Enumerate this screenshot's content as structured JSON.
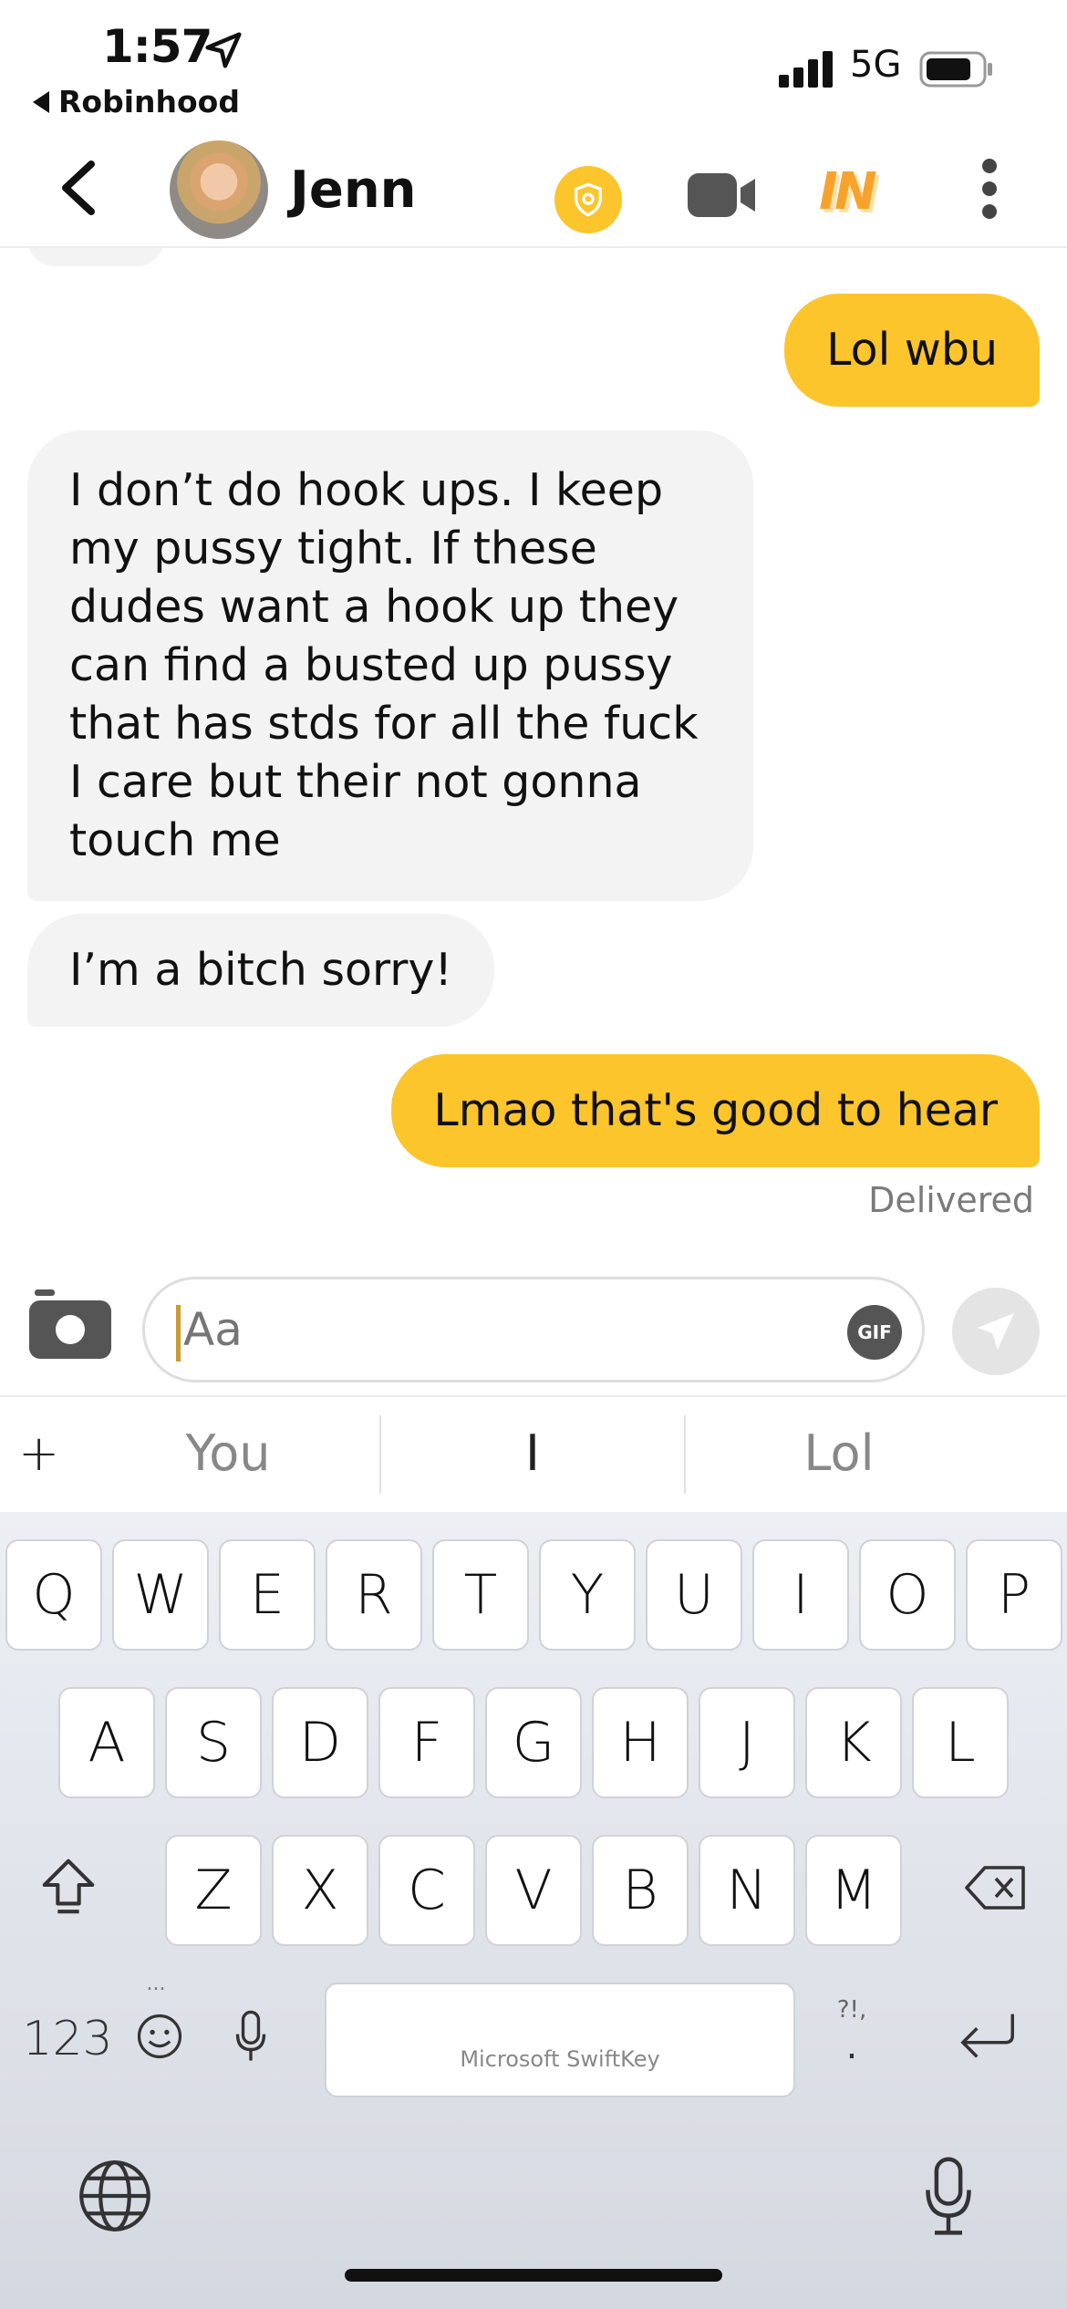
{
  "status_bar": {
    "time": "1:57",
    "back_app": "Robinhood",
    "network": "5G"
  },
  "header": {
    "contact_name": "Jenn",
    "in_badge": "IN"
  },
  "messages": [
    {
      "direction": "out",
      "text": "Lol wbu"
    },
    {
      "direction": "in",
      "text": "I don’t do hook ups. I keep my pussy tight. If these dudes want a hook up they can find a busted up pussy that has stds for all the fuck I care but their not gonna touch me"
    },
    {
      "direction": "in",
      "text": "I’m a bitch sorry!"
    },
    {
      "direction": "out",
      "text": "Lmao that's good to hear"
    }
  ],
  "delivery_status": "Delivered",
  "composer": {
    "placeholder": "Aa",
    "gif_label": "GIF"
  },
  "suggestions": {
    "plus": "+",
    "items": [
      "You",
      "I",
      "Lol"
    ]
  },
  "keyboard": {
    "row1": [
      "Q",
      "W",
      "E",
      "R",
      "T",
      "Y",
      "U",
      "I",
      "O",
      "P"
    ],
    "row2": [
      "A",
      "S",
      "D",
      "F",
      "G",
      "H",
      "J",
      "K",
      "L"
    ],
    "row3": [
      "Z",
      "X",
      "C",
      "V",
      "B",
      "N",
      "M"
    ],
    "numbers_label": "123",
    "punct_top": "?!,",
    "punct_bottom": ".",
    "space_label": "Microsoft SwiftKey",
    "emoji_dots": "..."
  },
  "colors": {
    "accent": "#fcc52c",
    "incoming_bubble": "#f3f3f3",
    "muted_text": "#7a7a7a"
  }
}
